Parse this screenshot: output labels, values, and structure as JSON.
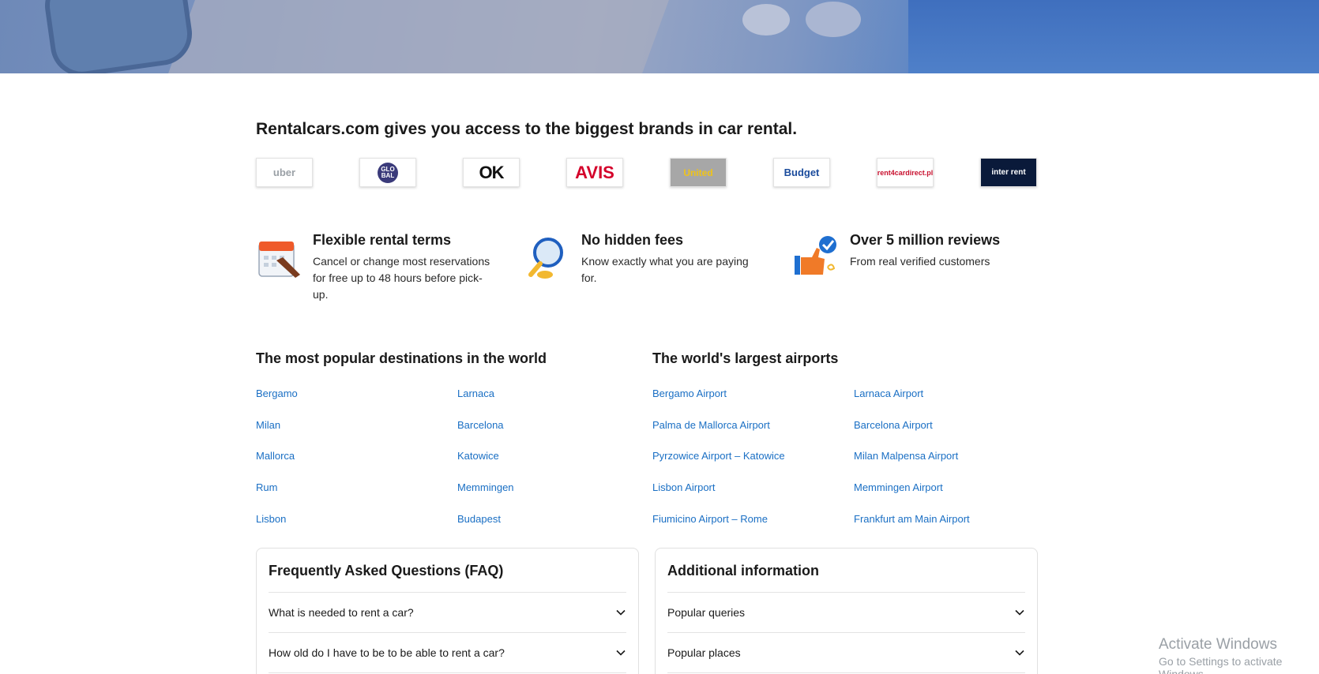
{
  "brands_section": {
    "title": "Rentalcars.com gives you access to the biggest brands in car rental.",
    "logos": [
      {
        "name": "uber",
        "text": "uber"
      },
      {
        "name": "global-rent-a-car",
        "text": "GLO BAL"
      },
      {
        "name": "ok-mobility",
        "text": "OK"
      },
      {
        "name": "avis",
        "text": "AVIS"
      },
      {
        "name": "united",
        "text": "United"
      },
      {
        "name": "budget",
        "text": "Budget"
      },
      {
        "name": "rent-a-car-direct",
        "text": "rent4cardirect.pl"
      },
      {
        "name": "interrent",
        "text": "inter rent"
      }
    ]
  },
  "features": [
    {
      "title": "Flexible rental terms",
      "text": "Cancel or change most reservations for free up to 48 hours before pick-up.",
      "icon": "calendar-icon"
    },
    {
      "title": "No hidden fees",
      "text": "Know exactly what you are paying for.",
      "icon": "magnifier-icon"
    },
    {
      "title": "Over 5 million reviews",
      "text": "From real verified customers",
      "icon": "thumbs-up-icon"
    }
  ],
  "destinations": {
    "title": "The most popular destinations in the world",
    "col1": [
      "Bergamo",
      "Milan",
      "Mallorca",
      "Rum",
      "Lisbon"
    ],
    "col2": [
      "Larnaca",
      "Barcelona",
      "Katowice",
      "Memmingen",
      "Budapest"
    ]
  },
  "airports": {
    "title": "The world's largest airports",
    "col1": [
      "Bergamo Airport",
      "Palma de Mallorca Airport",
      "Pyrzowice Airport – Katowice",
      "Lisbon Airport",
      "Fiumicino Airport – Rome"
    ],
    "col2": [
      "Larnaca Airport",
      "Barcelona Airport",
      "Milan Malpensa Airport",
      "Memmingen Airport",
      "Frankfurt am Main Airport"
    ]
  },
  "faq": {
    "title": "Frequently Asked Questions (FAQ)",
    "items": [
      "What is needed to rent a car?",
      "How old do I have to be to be able to rent a car?"
    ]
  },
  "additional": {
    "title": "Additional information",
    "items": [
      "Popular queries",
      "Popular places"
    ]
  },
  "watermark": {
    "line1": "Activate Windows",
    "line2": "Go to Settings to activate Windows."
  },
  "colors": {
    "link": "#1a6fc4",
    "hero_blue": "#4f80c9"
  }
}
